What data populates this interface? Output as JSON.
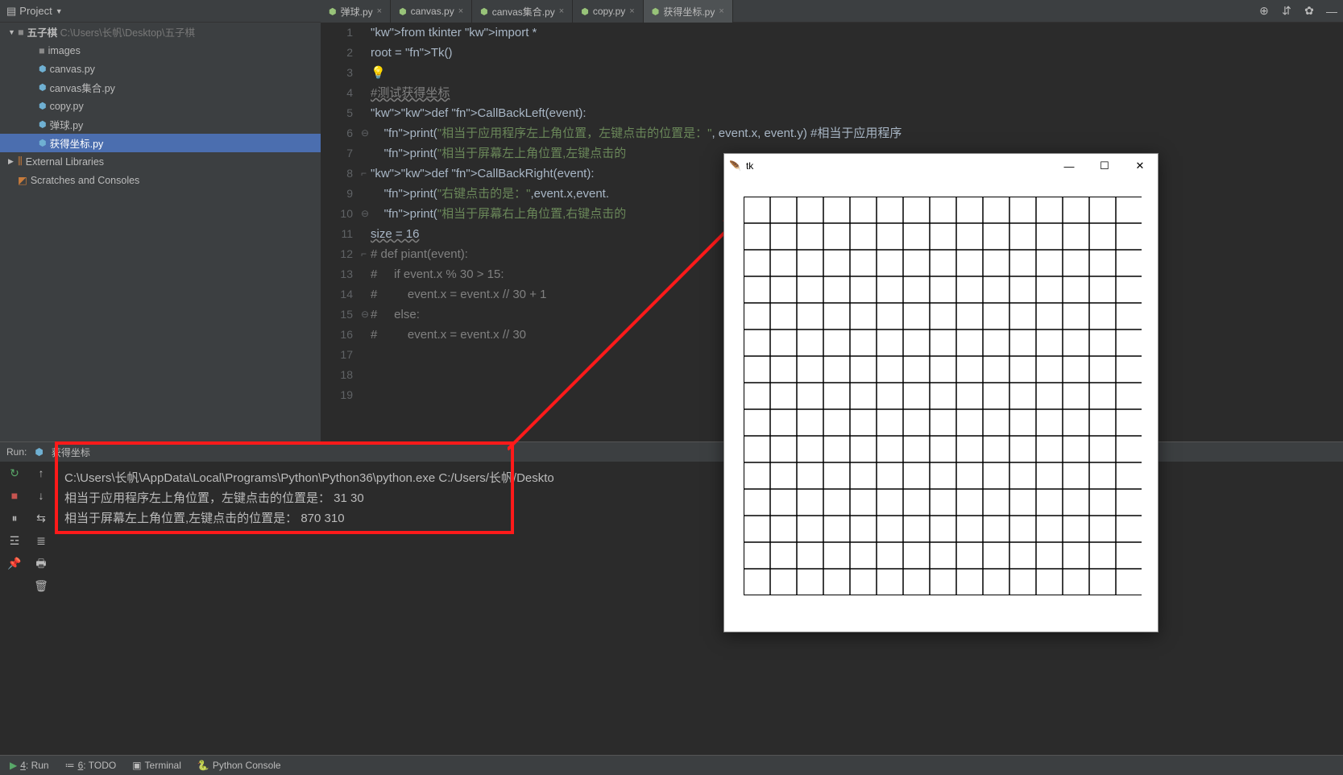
{
  "header": {
    "project_label": "Project"
  },
  "tabs": [
    {
      "label": "弹球.py",
      "active": false
    },
    {
      "label": "canvas.py",
      "active": false
    },
    {
      "label": "canvas集合.py",
      "active": false
    },
    {
      "label": "copy.py",
      "active": false
    },
    {
      "label": "获得坐标.py",
      "active": true
    }
  ],
  "tree": {
    "root": "五子棋",
    "root_path": "C:\\Users\\长帆\\Desktop\\五子棋",
    "items": [
      {
        "type": "folder",
        "label": "images",
        "indent": 38
      },
      {
        "type": "py",
        "label": "canvas.py",
        "indent": 38
      },
      {
        "type": "py",
        "label": "canvas集合.py",
        "indent": 38
      },
      {
        "type": "py",
        "label": "copy.py",
        "indent": 38
      },
      {
        "type": "py",
        "label": "弹球.py",
        "indent": 38
      },
      {
        "type": "py",
        "label": "获得坐标.py",
        "indent": 38,
        "selected": true
      }
    ],
    "ext_lib": "External Libraries",
    "scratches": "Scratches and Consoles"
  },
  "code": {
    "lines": [
      "from tkinter import *",
      "",
      "root = Tk()",
      "💡",
      "#测试获得坐标",
      "def CallBackLeft(event):",
      "    print(\"相当于应用程序左上角位置，左键点击的位置是：\", event.x, event.y) #相当于应用程序",
      "    print(\"相当于屏幕左上角位置,左键点击的",
      "",
      "def CallBackRight(event):",
      "    print(\"右键点击的是：\",event.x,event.",
      "    print(\"相当于屏幕右上角位置,右键点击的",
      "size = 16",
      "",
      "# def piant(event):",
      "#     if event.x % 30 > 15:",
      "#         event.x = event.x // 30 + 1",
      "#     else:",
      "#         event.x = event.x // 30"
    ],
    "line_numbers": [
      "1",
      "2",
      "3",
      "4",
      "5",
      "6",
      "7",
      "8",
      "9",
      "10",
      "11",
      "12",
      "13",
      "14",
      "15",
      "16",
      "17",
      "18",
      "19"
    ]
  },
  "run": {
    "label": "Run:",
    "script": "获得坐标",
    "output": [
      "C:\\Users\\长帆\\AppData\\Local\\Programs\\Python\\Python36\\python.exe C:/Users/长帆/Deskto",
      "相当于应用程序左上角位置，左键点击的位置是：  31 30",
      "相当于屏幕左上角位置,左键点击的位置是：  870 310"
    ]
  },
  "tk": {
    "title": "tk"
  },
  "bottom": {
    "run": "4: Run",
    "todo": "6: TODO",
    "terminal": "Terminal",
    "py_console": "Python Console"
  }
}
